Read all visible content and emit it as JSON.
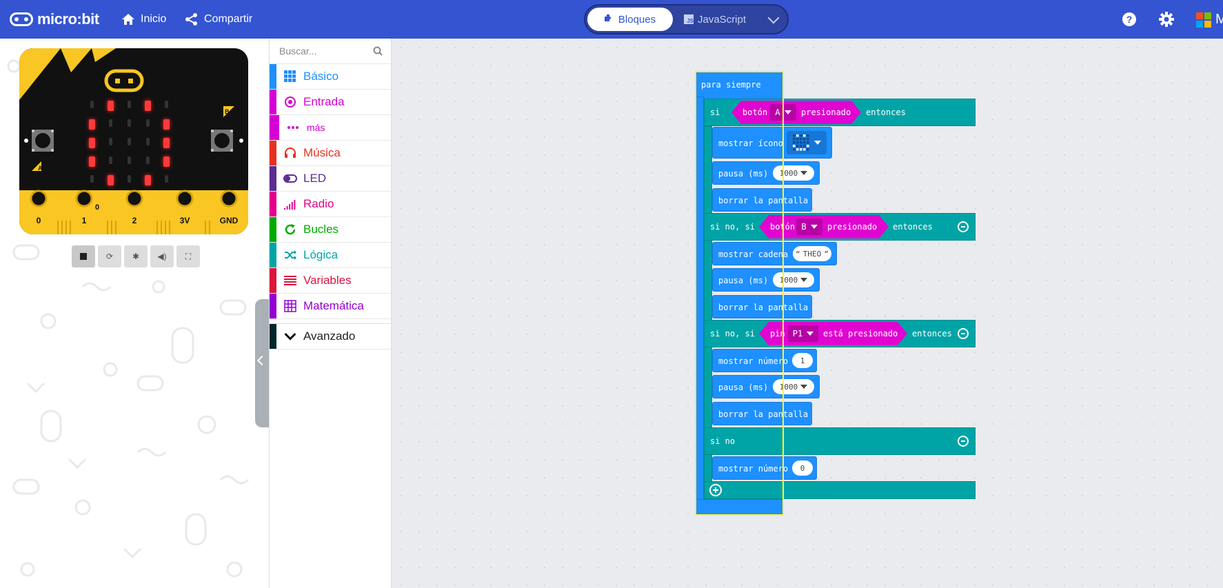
{
  "header": {
    "logo_text": "micro:bit",
    "nav": [
      {
        "label": "Inicio",
        "icon": "home-icon"
      },
      {
        "label": "Compartir",
        "icon": "share-icon"
      }
    ],
    "editor_toggle": {
      "blocks_label": "Bloques",
      "js_label": "JavaScript",
      "js_badge": "JS",
      "selected": "Bloques"
    },
    "right_icons": [
      "help-icon",
      "settings-icon"
    ],
    "ms_text": "M",
    "colors": {
      "bar": "#3454d1"
    }
  },
  "simulator": {
    "pins": [
      "0",
      "1",
      "2",
      "3V",
      "GND"
    ],
    "button_a": "A",
    "button_b": "B",
    "pin_readout": "0",
    "led_rows": [
      [
        0,
        1,
        0,
        1,
        0
      ],
      [
        1,
        0,
        0,
        0,
        1
      ],
      [
        1,
        0,
        0,
        0,
        1
      ],
      [
        1,
        0,
        0,
        0,
        1
      ],
      [
        0,
        1,
        0,
        1,
        0
      ]
    ],
    "controls": [
      "stop-icon",
      "restart-icon",
      "debug-icon",
      "mute-icon",
      "fullscreen-icon"
    ]
  },
  "toolbox": {
    "search_placeholder": "Buscar...",
    "categories": [
      {
        "label": "Básico",
        "color": "#1e90ff",
        "icon": "grid-icon"
      },
      {
        "label": "Entrada",
        "color": "#d400d4",
        "icon": "target-icon"
      },
      {
        "label": "más",
        "color": "#d400d4",
        "icon": "more-icon"
      },
      {
        "label": "Música",
        "color": "#e63022",
        "icon": "headphones-icon"
      },
      {
        "label": "LED",
        "color": "#5c2d91",
        "icon": "toggle-icon"
      },
      {
        "label": "Radio",
        "color": "#e3008c",
        "icon": "signal-icon"
      },
      {
        "label": "Bucles",
        "color": "#00aa00",
        "icon": "loop-icon"
      },
      {
        "label": "Lógica",
        "color": "#00a4a6",
        "icon": "shuffle-icon"
      },
      {
        "label": "Variables",
        "color": "#dc143c",
        "icon": "lines-icon"
      },
      {
        "label": "Matemática",
        "color": "#9400d3",
        "icon": "calculator-icon"
      }
    ],
    "advanced": {
      "label": "Avanzado",
      "color": "#00272b",
      "icon": "chevron-down-icon"
    }
  },
  "workspace": {
    "forever_label": "para siempre",
    "if_label": "si",
    "then_label": "entonces",
    "elseif_label": "si no, si",
    "else_label": "si no",
    "cond1": {
      "prefix": "botón",
      "value": "A",
      "suffix": "presionado"
    },
    "cond2": {
      "prefix": "botón",
      "value": "B",
      "suffix": "presionado"
    },
    "cond3": {
      "prefix": "pin",
      "value": "P1",
      "suffix": "está presionado"
    },
    "show_icon_label": "mostrar ícono",
    "pause_label": "pausa (ms)",
    "pause_value": "1000",
    "clear_label": "borrar la pantalla",
    "show_string_label": "mostrar cadena",
    "string_value": "THEO",
    "string_quote_open": "“",
    "string_quote_close": "”",
    "show_number_label": "mostrar número",
    "number_value_1": "1",
    "number_value_2": "0"
  }
}
